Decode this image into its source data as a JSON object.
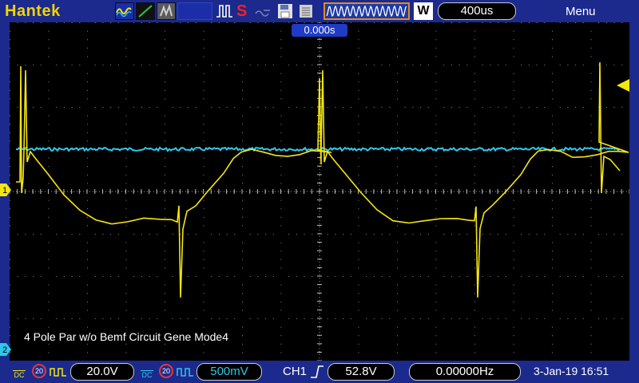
{
  "header": {
    "brand": "Hantek",
    "run_state": "S",
    "timebase_mode": "W",
    "timebase": "400us",
    "menu_label": "Menu"
  },
  "screen": {
    "trigger_position": "0.000s",
    "caption": "4 Pole Par w/o Bemf Circuit Gene Mode4",
    "ch1_marker": "1",
    "ch2_marker": "2"
  },
  "footer": {
    "ch1": {
      "coupling": "DC",
      "bw_limit": "20",
      "volts_div": "20.0V"
    },
    "ch2": {
      "coupling": "DC",
      "bw_limit": "20",
      "volts_div": "500mV"
    },
    "trigger_source": "CH1",
    "trigger_level": "52.8V",
    "frequency": "0.00000Hz",
    "datetime": "3-Jan-19 16:51"
  },
  "colors": {
    "ch1": "#f5e60f",
    "ch2": "#2ec8e8",
    "frame": "#1b2a8c",
    "accent": "#e28b22"
  },
  "icons": {
    "ch1_wave": "yellow-sine-wave-icon",
    "trigger_edge": "rising-edge-icon"
  }
}
